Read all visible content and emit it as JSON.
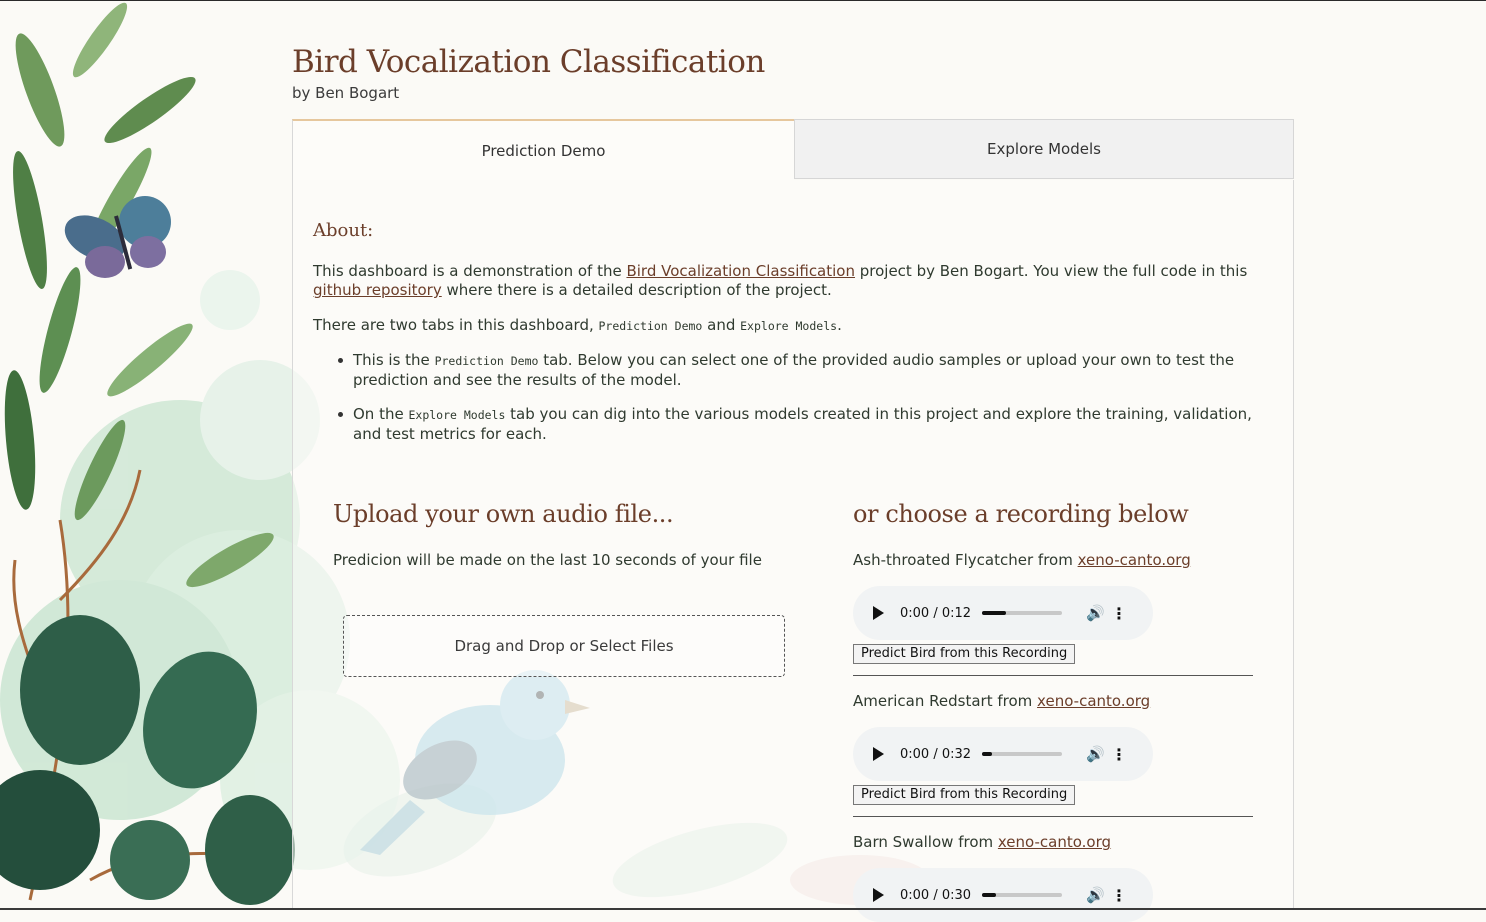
{
  "header": {
    "title": "Bird Vocalization Classification",
    "byline": "by Ben Bogart"
  },
  "tabs": [
    {
      "label": "Prediction Demo",
      "active": true
    },
    {
      "label": "Explore Models",
      "active": false
    }
  ],
  "about": {
    "heading": "About:",
    "p1_a": "This dashboard is a demonstration of the ",
    "p1_link1": "Bird Vocalization Classification",
    "p1_b": " project by Ben Bogart. You view the full code in this",
    "p1_link2": "github repository",
    "p1_c": " where there is a detailed description of the project.",
    "p2_a": "There are two tabs in this dashboard, ",
    "p2_code1": "Prediction Demo",
    "p2_b": " and ",
    "p2_code2": "Explore Models",
    "p2_c": ".",
    "b1_a": "This is the ",
    "b1_code": "Prediction Demo",
    "b1_b": " tab. Below you can select one of the provided audio samples or upload your own to test the prediction and see the results of the model.",
    "b2_a": "On the ",
    "b2_code": "Explore Models",
    "b2_b": " tab you can dig into the various models created in this project and explore the training, validation, and test metrics for each."
  },
  "upload": {
    "heading": "Upload your own audio file...",
    "note": "Predicion will be made on the last 10 seconds of your file",
    "dropzone": "Drag and Drop or Select Files"
  },
  "recordings": {
    "heading": "or choose a recording below",
    "source_prefix": " from ",
    "source_link": "xeno-canto.org",
    "predict_label": "Predict Bird from this Recording",
    "items": [
      {
        "bird": "Ash-throated Flycatcher",
        "time": "0:00 / 0:12",
        "progress": 0.3
      },
      {
        "bird": "American Redstart",
        "time": "0:00 / 0:32",
        "progress": 0.12
      },
      {
        "bird": "Barn Swallow",
        "time": "0:00 / 0:30",
        "progress": 0.17
      }
    ]
  },
  "colors": {
    "accent": "#6b3e2a",
    "tab_border": "#e6c79d"
  },
  "icons": [
    "play-icon",
    "volume-icon",
    "more-vert-icon"
  ]
}
